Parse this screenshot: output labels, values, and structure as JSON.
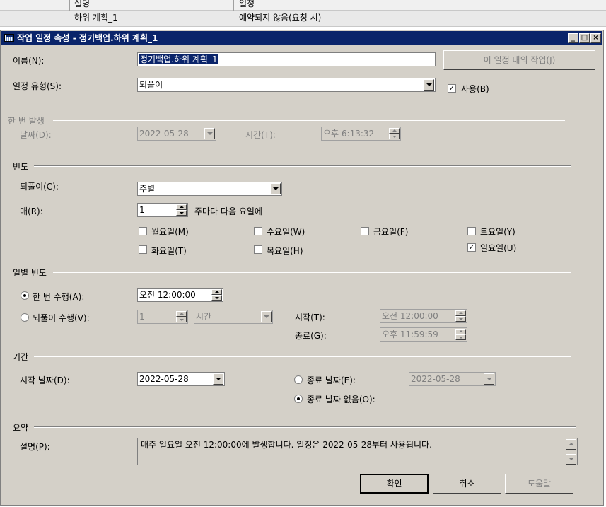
{
  "background_grid": {
    "headers": [
      "설명",
      "일정"
    ],
    "row": [
      "하위 계획_1",
      "예약되지 않음(요청 시)"
    ]
  },
  "dialog": {
    "title": "작업 일정 속성 - 정기백업.하위 계획_1",
    "title_buttons": [
      "_",
      "□",
      "×"
    ],
    "name_label": "이름(N):",
    "name_value": "정기백업.하위 계획_1",
    "jobs_button": "이 일정 내의 작업(J)",
    "schedule_type_label": "일정 유형(S):",
    "schedule_type_value": "되풀이",
    "enabled_label": "사용(B)",
    "enabled_checked": true,
    "one_time": {
      "group": "한 번 발생",
      "date_label": "날짜(D):",
      "date_value": "2022-05-28",
      "time_label": "시간(T):",
      "time_value": "오후  6:13:32"
    },
    "frequency": {
      "group": "빈도",
      "recurs_label": "되풀이(C):",
      "recurs_value": "주별",
      "every_label": "매(R):",
      "every_value": "1",
      "every_suffix": "주마다 다음 요일에",
      "days": [
        {
          "label": "월요일(M)",
          "checked": false
        },
        {
          "label": "화요일(T)",
          "checked": false
        },
        {
          "label": "수요일(W)",
          "checked": false
        },
        {
          "label": "목요일(H)",
          "checked": false
        },
        {
          "label": "금요일(F)",
          "checked": false
        },
        {
          "label": "토요일(Y)",
          "checked": false
        },
        {
          "label": "일요일(U)",
          "checked": true
        }
      ]
    },
    "daily": {
      "group": "일별 빈도",
      "once_label": "한 번 수행(A):",
      "once_selected": true,
      "once_value": "오전 12:00:00",
      "every_label": "되풀이 수행(V):",
      "every_value": "1",
      "every_unit": "시간",
      "start_label": "시작(T):",
      "start_value": "오전 12:00:00",
      "end_label": "종료(G):",
      "end_value": "오후 11:59:59"
    },
    "duration": {
      "group": "기간",
      "start_label": "시작 날짜(D):",
      "start_value": "2022-05-28",
      "end_date_label": "종료 날짜(E):",
      "end_date_value": "2022-05-28",
      "no_end_label": "종료 날짜 없음(O):",
      "no_end_selected": true
    },
    "summary": {
      "group": "요약",
      "desc_label": "설명(P):",
      "desc_value": "매주 일요일 오전 12:00:00에 발생합니다. 일정은 2022-05-28부터 사용됩니다."
    },
    "buttons": {
      "ok": "확인",
      "cancel": "취소",
      "help": "도움말"
    }
  }
}
